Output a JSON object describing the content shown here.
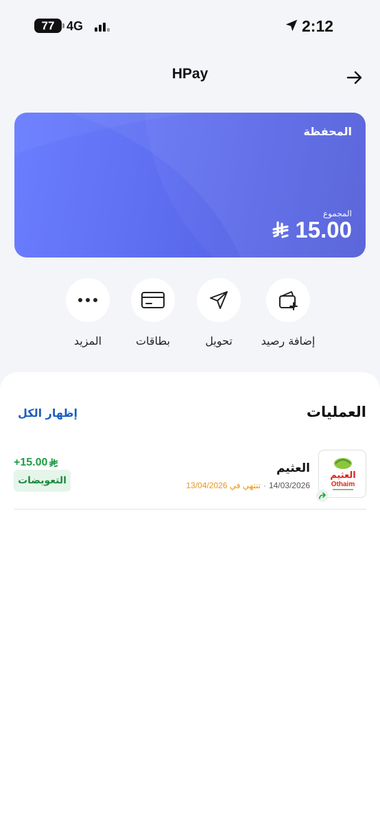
{
  "status_bar": {
    "battery": "77",
    "network": "4G",
    "time": "2:12"
  },
  "header": {
    "title": "HPay"
  },
  "wallet": {
    "label": "المحفظة",
    "total_label": "المجموع",
    "total_amount": "15.00"
  },
  "actions": [
    {
      "label": "إضافة رصيد",
      "icon": "wallet-add-icon"
    },
    {
      "label": "تحويل",
      "icon": "send-icon"
    },
    {
      "label": "بطاقات",
      "icon": "card-icon"
    },
    {
      "label": "المزيد",
      "icon": "more-icon"
    }
  ],
  "transactions": {
    "title": "العمليات",
    "show_all": "إظهار الكل",
    "items": [
      {
        "merchant": "العثيم",
        "date": "14/03/2026",
        "separator": "·",
        "expiry": "تنتهي في 13/04/2026",
        "amount": "+15.00",
        "tag": "التعويضات",
        "logo_text": "العثيم",
        "logo_text_latin": "Othaim"
      }
    ]
  },
  "colors": {
    "card_gradient_start": "#6b7eff",
    "card_gradient_end": "#4d58d8",
    "link": "#1b5fbf",
    "positive": "#1f9c46",
    "expiry": "#e8961e"
  }
}
